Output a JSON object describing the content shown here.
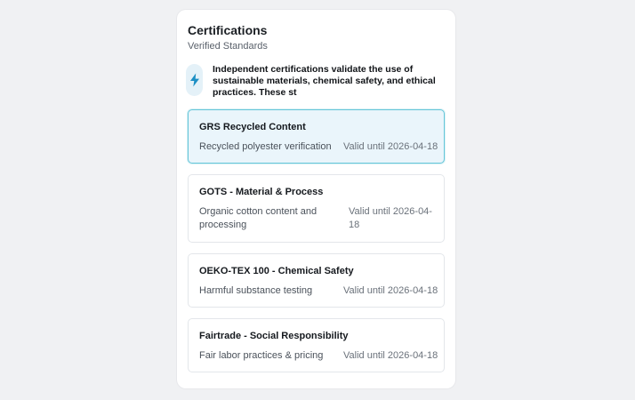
{
  "card": {
    "title": "Certifications",
    "subtitle": "Verified Standards",
    "info_icon": "lightning-bolt-icon",
    "info_text": "Independent certifications validate the use of sustainable materials, chemical safety, and ethical practices. These st",
    "accent_color": "#1d8fc4"
  },
  "certifications": [
    {
      "name": "GRS Recycled Content",
      "description": "Recycled polyester verification",
      "valid": "Valid until 2026-04-18",
      "selected": true
    },
    {
      "name": "GOTS - Material & Process",
      "description": "Organic cotton content and processing",
      "valid": "Valid until 2026-04-18",
      "selected": false
    },
    {
      "name": "OEKO-TEX 100 - Chemical Safety",
      "description": "Harmful substance testing",
      "valid": "Valid until 2026-04-18",
      "selected": false
    },
    {
      "name": "Fairtrade - Social Responsibility",
      "description": "Fair labor practices & pricing",
      "valid": "Valid until 2026-04-18",
      "selected": false
    }
  ]
}
